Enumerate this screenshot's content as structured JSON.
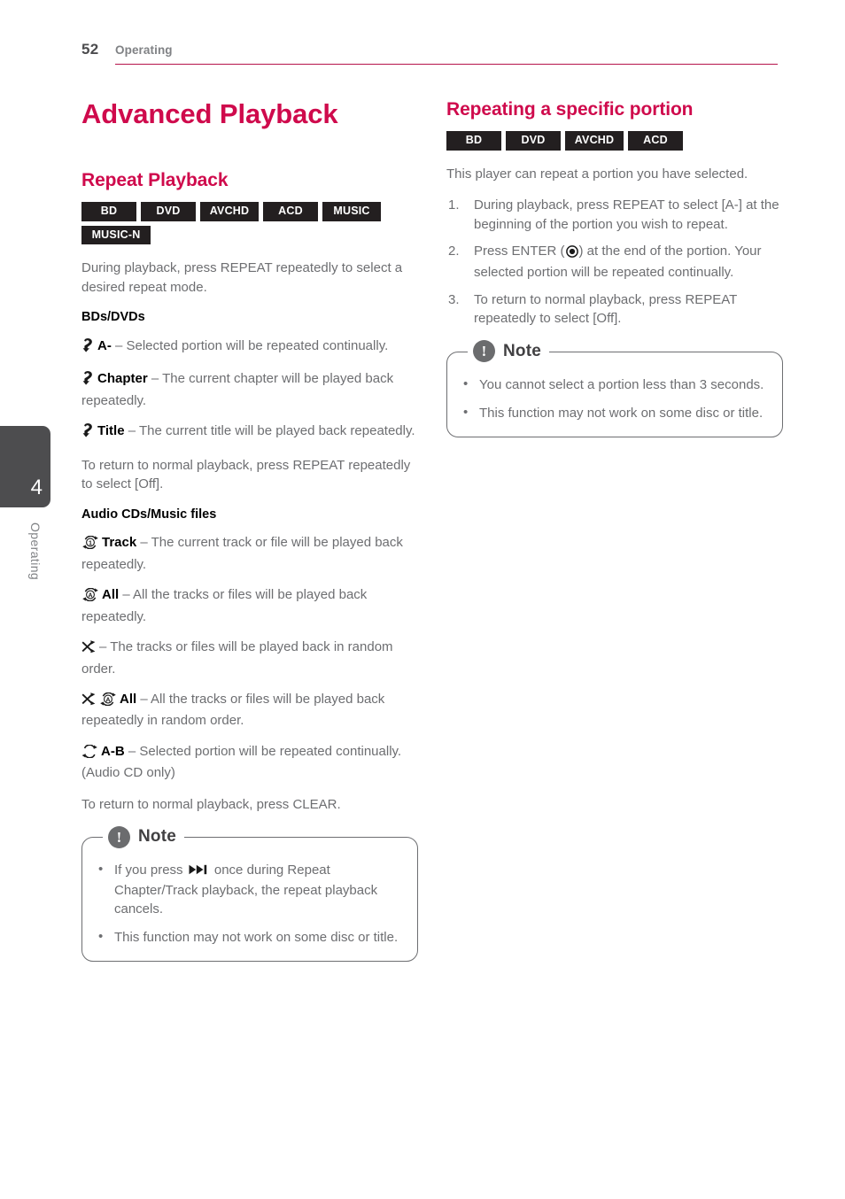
{
  "header": {
    "page_number": "52",
    "section": "Operating",
    "rule_color": "#b6134a"
  },
  "side_tab": {
    "chapter_number": "4",
    "label": "Operating",
    "background": "#4d4d4f"
  },
  "theme": {
    "accent": "#cf0a4c",
    "badge_bg": "#231f20",
    "body_text": "#6d6e71"
  },
  "left_column": {
    "title": "Advanced Playback",
    "section": {
      "heading": "Repeat Playback",
      "badges": [
        "BD",
        "DVD",
        "AVCHD",
        "ACD",
        "MUSIC",
        "MUSIC-N"
      ],
      "intro": "During playback, press REPEAT repeatedly to select a desired repeat mode.",
      "subhead_1": "BDs/DVDs",
      "items_bd": [
        {
          "icon": "repeat-loop-icon",
          "label": "A-",
          "text": " – Selected portion will be repeated continually."
        },
        {
          "icon": "repeat-loop-icon",
          "label": "Chapter",
          "text": " – The current chapter will be played back repeatedly."
        },
        {
          "icon": "repeat-loop-icon",
          "label": "Title",
          "text": " – The current title will be played back repeatedly."
        }
      ],
      "return_text_1": "To return to normal playback, press REPEAT repeatedly to select [Off].",
      "subhead_2": "Audio CDs/Music files",
      "items_cd": [
        {
          "icon": "repeat-track-one-icon",
          "label": "Track",
          "text": " – The current track or file will be played back repeatedly."
        },
        {
          "icon": "repeat-all-icon",
          "label": "All",
          "text": " – All the tracks or files will be played back repeatedly."
        },
        {
          "icon": "shuffle-icon",
          "label": "",
          "text": "– The tracks or files will be played back in random order."
        },
        {
          "icon": "shuffle-repeat-all-icon",
          "label": "All",
          "text": " – All the tracks or files will be played back repeatedly in random order."
        },
        {
          "icon": "repeat-ab-icon",
          "label": "A-B",
          "text": " – Selected portion will be repeated continually. (Audio CD only)"
        }
      ],
      "return_text_2": "To return to normal playback, press CLEAR."
    },
    "note": {
      "title": "Note",
      "badge_glyph": "!",
      "items": [
        {
          "before": "If you press ",
          "icon": "skip-forward-icon",
          "after": " once during Repeat Chapter/Track playback, the repeat playback cancels."
        },
        {
          "before": "This function may not work on some disc or title.",
          "icon": "",
          "after": ""
        }
      ]
    }
  },
  "right_column": {
    "heading": "Repeating a specific portion",
    "badges": [
      "BD",
      "DVD",
      "AVCHD",
      "ACD"
    ],
    "intro": "This player can repeat a portion you have selected.",
    "steps": [
      {
        "before": "During playback, press REPEAT to select [A-] at the beginning of the portion you wish to repeat.",
        "icon": "",
        "after": ""
      },
      {
        "before": "Press ENTER (",
        "icon": "enter-button-icon",
        "after": ") at the end of the portion. Your selected portion will be repeated continually."
      },
      {
        "before": "To return to normal playback, press REPEAT repeatedly to select [Off].",
        "icon": "",
        "after": ""
      }
    ],
    "note": {
      "title": "Note",
      "badge_glyph": "!",
      "items": [
        {
          "before": "You cannot select a portion less than 3 seconds.",
          "icon": "",
          "after": ""
        },
        {
          "before": "This function may not work on some disc or title.",
          "icon": "",
          "after": ""
        }
      ]
    }
  }
}
